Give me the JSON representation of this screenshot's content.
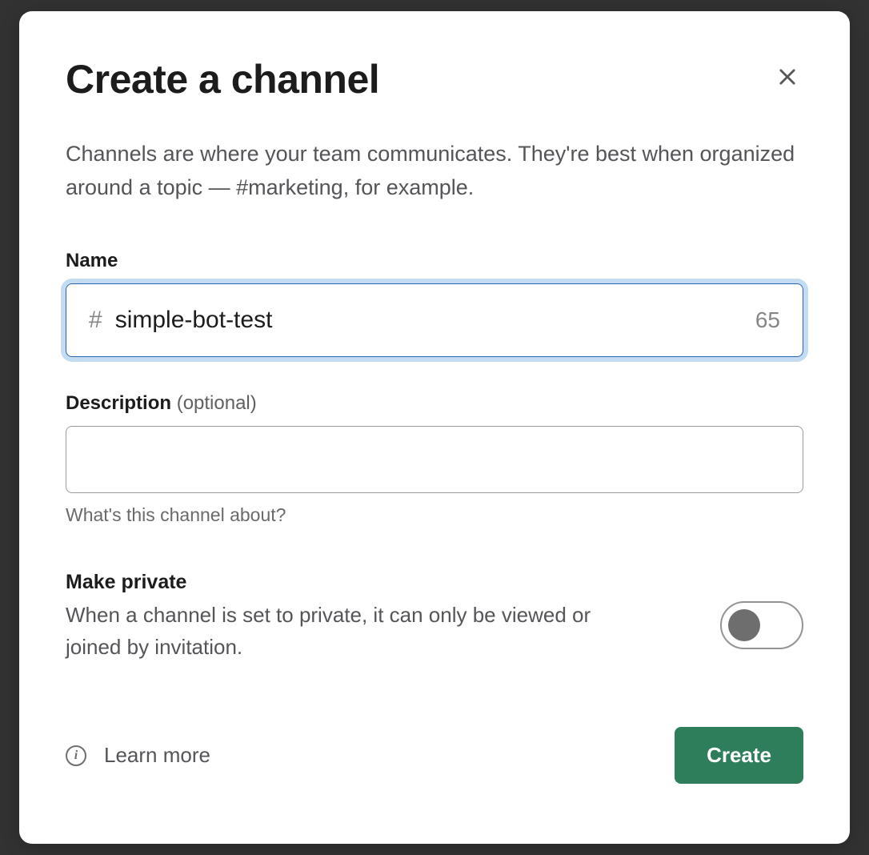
{
  "modal": {
    "title": "Create a channel",
    "description": "Channels are where your team communicates. They're best when organized around a topic — #marketing, for example.",
    "name_field": {
      "label": "Name",
      "prefix": "#",
      "value": "simple-bot-test",
      "char_count": "65"
    },
    "description_field": {
      "label": "Description",
      "optional": "(optional)",
      "value": "",
      "helper": "What's this channel about?"
    },
    "private": {
      "title": "Make private",
      "description": "When a channel is set to private, it can only be viewed or joined by invitation.",
      "enabled": false
    },
    "footer": {
      "learn_more": "Learn more",
      "create_label": "Create"
    }
  }
}
